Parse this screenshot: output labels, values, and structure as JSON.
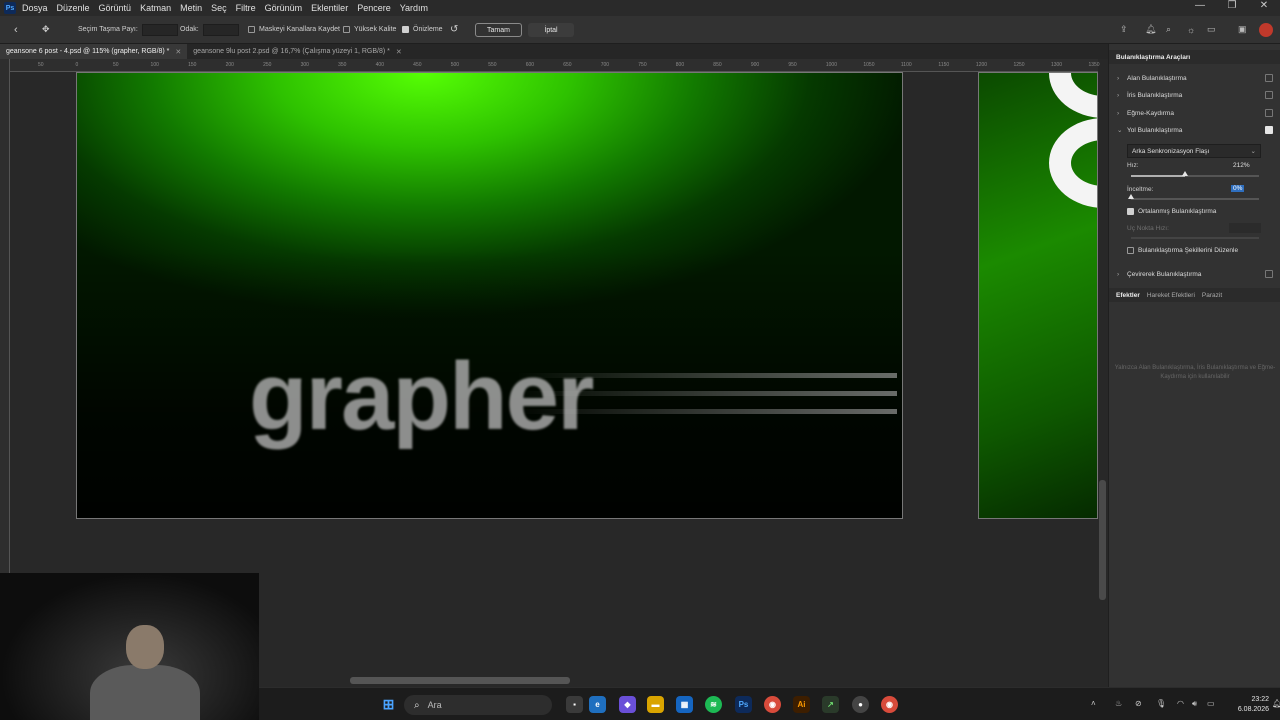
{
  "app": {
    "logo": "Ps",
    "menu": [
      "Dosya",
      "Düzenle",
      "Görüntü",
      "Katman",
      "Metin",
      "Seç",
      "Filtre",
      "Görünüm",
      "Eklentiler",
      "Pencere",
      "Yardım"
    ]
  },
  "options_bar": {
    "selection_bleed_label": "Seçim Taşma Payı:",
    "focus_label": "Odak:",
    "save_mask_label": "Maskeyi Kanallara Kaydet",
    "high_quality_label": "Yüksek Kalite",
    "preview_label": "Önizleme",
    "preview_checked": true,
    "ok_label": "Tamam",
    "cancel_label": "İptal"
  },
  "tabs": [
    {
      "label": "geansone 6 post - 4.psd @ 115% (grapher, RGB/8) *",
      "active": true
    },
    {
      "label": "geansone 9lu post 2.psd @ 16,7% (Çalışma yüzeyi 1, RGB/8) *",
      "active": false
    }
  ],
  "ruler_labels": [
    "50",
    "0",
    "50",
    "100",
    "150",
    "200",
    "250",
    "300",
    "350",
    "400",
    "450",
    "500",
    "550",
    "600",
    "650",
    "700",
    "750",
    "800",
    "850",
    "900",
    "950",
    "1000",
    "1050",
    "1100",
    "1150",
    "1200",
    "1250",
    "1300",
    "1350"
  ],
  "canvas": {
    "wordmark": "grapher"
  },
  "panel": {
    "title": "Bulanıklaştırma Araçları",
    "items": [
      {
        "label": "Alan Bulanıklaştırma",
        "checked": false
      },
      {
        "label": "İris Bulanıklaştırma",
        "checked": false
      },
      {
        "label": "Eğme-Kaydırma",
        "checked": false
      },
      {
        "label": "Yol Bulanıklaştırma",
        "checked": true
      },
      {
        "label": "Çevirerek Bulanıklaştırma",
        "checked": false
      }
    ],
    "dropdown_value": "Arka Senkronizasyon Flaşı",
    "speed_label": "Hız:",
    "speed_value": "212%",
    "speed_fraction": 0.42,
    "taper_label": "İnceltme:",
    "taper_value": "0%",
    "taper_fraction": 0.0,
    "centered_label": "Ortalanmış Bulanıklaştırma",
    "endpoint_label": "Uç Nokta Hızı:",
    "edit_shapes_label": "Bulanıklaştırma Şekillerini Düzenle",
    "tabs": [
      "Efektler",
      "Hareket Efektleri",
      "Parazit"
    ],
    "note": "Yalnızca Alan Bulanıklaştırma, İris Bulanıklaştırma ve Eğme-Kaydırma için kullanılabilir"
  },
  "taskbar": {
    "search_placeholder": "Ara",
    "time": "23:22",
    "date": "6.08.2026"
  }
}
